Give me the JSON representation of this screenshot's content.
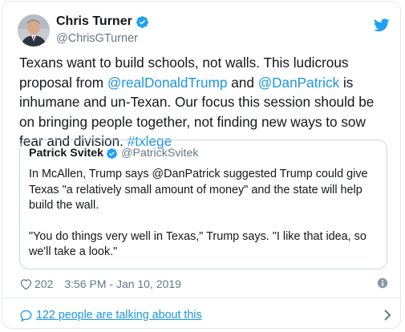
{
  "author": {
    "name": "Chris Turner",
    "handle": "@ChrisGTurner"
  },
  "tweet": {
    "segments": [
      {
        "type": "text",
        "value": "Texans want to build schools, not walls. This ludicrous proposal from "
      },
      {
        "type": "link",
        "value": "@realDonaldTrump"
      },
      {
        "type": "text",
        "value": " and "
      },
      {
        "type": "link",
        "value": "@DanPatrick"
      },
      {
        "type": "text",
        "value": " is inhumane and un-Texan. Our focus this session should be on bringing people together, not finding new ways to sow fear and division. "
      },
      {
        "type": "link",
        "value": "#txlege"
      }
    ]
  },
  "quote": {
    "name": "Patrick Svitek",
    "handle": "@PatrickSvitek",
    "paragraph1": "In McAllen, Trump says @DanPatrick suggested Trump could give Texas \"a relatively small amount of money\" and the state will help build the wall.",
    "paragraph2": "\"You do things very well in Texas,\" Trump says. \"I like that idea, so we'll take a look.\""
  },
  "footer": {
    "likes": "202",
    "timestamp": "3:56 PM - Jan 10, 2019"
  },
  "conversation": {
    "label": "122 people are talking about this"
  },
  "colors": {
    "link": "#1b95e0",
    "verified": "#1da1f2",
    "secondary_text": "#657786",
    "border": "#e1e8ed"
  },
  "icons": [
    "verified-badge-icon",
    "twitter-bird-icon",
    "heart-icon",
    "info-icon",
    "comment-bubble-icon",
    "chevron-right-icon"
  ]
}
